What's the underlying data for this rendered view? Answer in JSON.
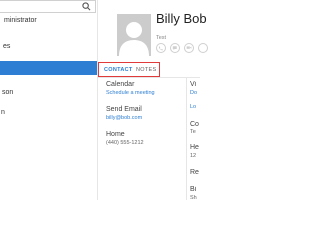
{
  "people_list": {
    "items": [
      {
        "label": "ministrator",
        "selected": false
      },
      {
        "label": "es",
        "selected": false
      },
      {
        "label": "",
        "selected": true
      },
      {
        "label": "son",
        "selected": false
      },
      {
        "label": "n",
        "selected": false
      }
    ]
  },
  "contact": {
    "name": "Billy Bob",
    "subtitle": "Test",
    "tabs": [
      {
        "label": "CONTACT",
        "active": true
      },
      {
        "label": "NOTES",
        "active": false
      }
    ],
    "fields": [
      {
        "label": "Calendar",
        "value": "Schedule a meeting",
        "link": true
      },
      {
        "label": "Send Email",
        "value": "billy@bob.com",
        "link": true
      },
      {
        "label": "Home",
        "value": "(440) 555-1212",
        "link": false
      }
    ],
    "right_column_fragments": [
      "Vi",
      "Do",
      "Lo",
      "Co",
      "Te",
      "He",
      "12",
      "Re",
      "Bi",
      "Sh"
    ]
  },
  "colors": {
    "accent": "#2e7fd3",
    "highlight_frame": "#e03a3a",
    "avatar_bg": "#cccccc"
  },
  "icons": [
    "search-icon",
    "avatar-placeholder-icon",
    "phone-icon",
    "message-icon",
    "video-icon",
    "mail-icon"
  ]
}
